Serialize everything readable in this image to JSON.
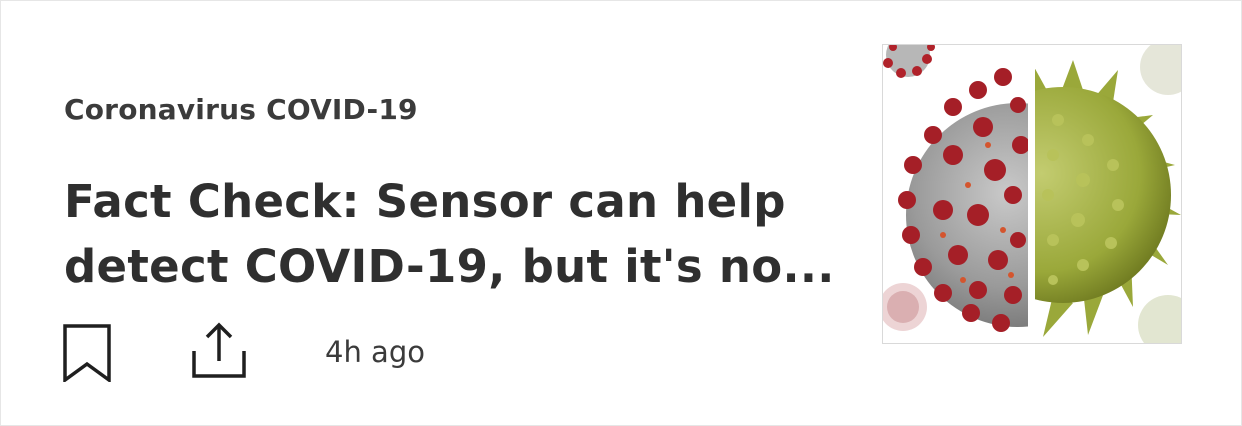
{
  "article": {
    "category": "Coronavirus COVID-19",
    "headline": "Fact Check: Sensor can help detect COVID-19, but it's no...",
    "timestamp": "4h ago"
  },
  "icons": {
    "bookmark": "bookmark-icon",
    "share": "share-icon"
  },
  "colors": {
    "text_primary": "#2f2f2f",
    "text_secondary": "#3b3b3b",
    "virus_red": "#b0222a",
    "virus_gray": "#9a9a9a",
    "pollen_green": "#9aa83a"
  }
}
